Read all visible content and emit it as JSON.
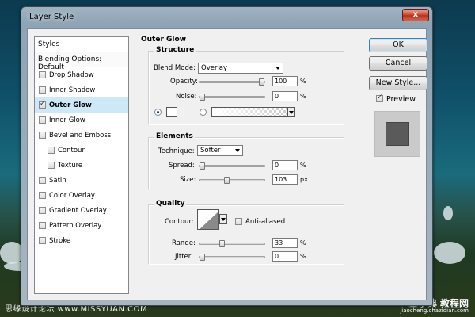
{
  "dialog": {
    "title": "Layer Style",
    "close_glyph": "x"
  },
  "styles_panel": {
    "header": "Styles",
    "blending_default": "Blending Options: Default",
    "items": [
      {
        "label": "Drop Shadow",
        "checked": false,
        "selected": false,
        "sub": false
      },
      {
        "label": "Inner Shadow",
        "checked": false,
        "selected": false,
        "sub": false
      },
      {
        "label": "Outer Glow",
        "checked": true,
        "selected": true,
        "sub": false
      },
      {
        "label": "Inner Glow",
        "checked": false,
        "selected": false,
        "sub": false
      },
      {
        "label": "Bevel and Emboss",
        "checked": false,
        "selected": false,
        "sub": false
      },
      {
        "label": "Contour",
        "checked": false,
        "selected": false,
        "sub": true
      },
      {
        "label": "Texture",
        "checked": false,
        "selected": false,
        "sub": true
      },
      {
        "label": "Satin",
        "checked": false,
        "selected": false,
        "sub": false
      },
      {
        "label": "Color Overlay",
        "checked": false,
        "selected": false,
        "sub": false
      },
      {
        "label": "Gradient Overlay",
        "checked": false,
        "selected": false,
        "sub": false
      },
      {
        "label": "Pattern Overlay",
        "checked": false,
        "selected": false,
        "sub": false
      },
      {
        "label": "Stroke",
        "checked": false,
        "selected": false,
        "sub": false
      }
    ]
  },
  "outer_glow": {
    "title": "Outer Glow",
    "structure": {
      "title": "Structure",
      "blend_mode_label": "Blend Mode:",
      "blend_mode_value": "Overlay",
      "opacity_label": "Opacity:",
      "opacity_value": "100",
      "opacity_level": 100,
      "noise_label": "Noise:",
      "noise_value": "0",
      "noise_level": 0,
      "percent": "%"
    },
    "elements": {
      "title": "Elements",
      "technique_label": "Technique:",
      "technique_value": "Softer",
      "spread_label": "Spread:",
      "spread_value": "0",
      "spread_level": 0,
      "size_label": "Size:",
      "size_value": "103",
      "size_level": 41,
      "percent": "%",
      "px": "px"
    },
    "quality": {
      "title": "Quality",
      "contour_label": "Contour:",
      "anti_aliased_label": "Anti-aliased",
      "anti_aliased_checked": false,
      "range_label": "Range:",
      "range_value": "33",
      "range_level": 33,
      "jitter_label": "Jitter:",
      "jitter_value": "0",
      "jitter_level": 0,
      "percent": "%"
    }
  },
  "buttons": {
    "ok": "OK",
    "cancel": "Cancel",
    "new_style": "New Style...",
    "preview_label": "Preview",
    "preview_checked": true
  },
  "watermarks": {
    "left": "思缘设计论坛 www.MISSYUAN.COM",
    "right_top": "查字典 教程网",
    "right_bottom": "jiaocheng.chazidian.com"
  }
}
